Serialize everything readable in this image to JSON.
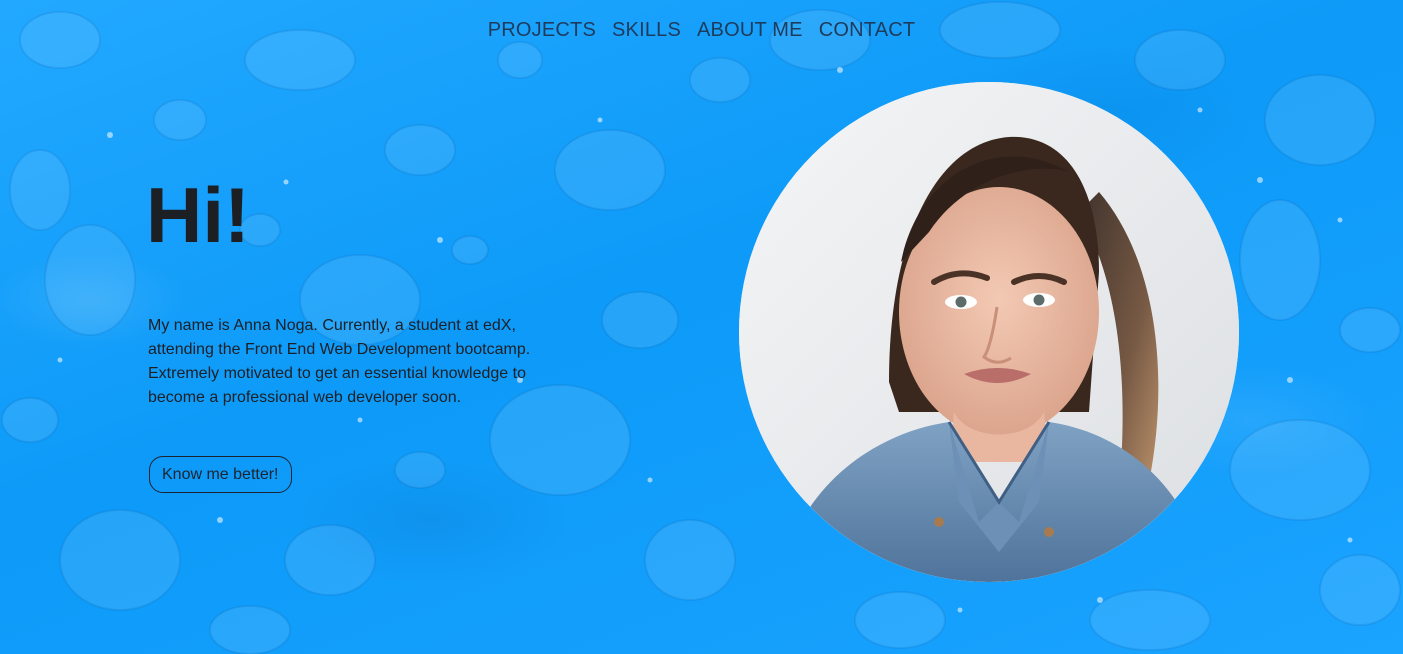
{
  "nav": {
    "items": [
      {
        "label": "PROJECTS"
      },
      {
        "label": "SKILLS"
      },
      {
        "label": "ABOUT ME"
      },
      {
        "label": "CONTACT"
      }
    ]
  },
  "hero": {
    "title": "Hi!",
    "description": "My name is Anna Noga. Currently, a student at edX, attending the Front End Web Development bootcamp. Extremely motivated to get an essential knowledge to become a professional web developer soon.",
    "cta_label": "Know me better!"
  },
  "colors": {
    "background": "#0d9af8",
    "text": "#1c1f24",
    "nav_text": "#1f3b5c"
  }
}
